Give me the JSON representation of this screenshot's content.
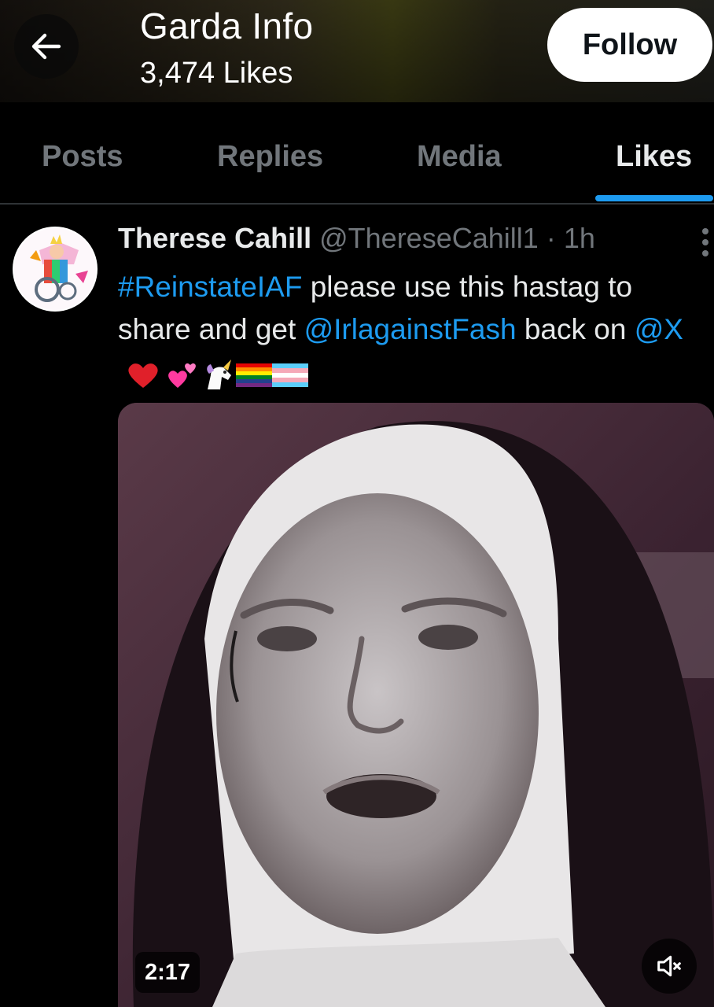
{
  "header": {
    "profile_name": "Garda Info",
    "subtitle": "3,474 Likes",
    "follow_label": "Follow"
  },
  "tabs": [
    {
      "label": "Posts",
      "active": false
    },
    {
      "label": "Replies",
      "active": false
    },
    {
      "label": "Media",
      "active": false
    },
    {
      "label": "Likes",
      "active": true
    }
  ],
  "post": {
    "author_name": "Therese Cahill",
    "author_handle": "@ThereseCahill1",
    "separator": "·",
    "time": "1h",
    "hashtag": "#ReinstateIAF",
    "text_1": "please use this hastag to share and get",
    "mention_1": "@IrlagainstFash",
    "text_2": "back on",
    "mention_2": "@X",
    "emojis": [
      "red-heart",
      "two-hearts",
      "unicorn",
      "rainbow-flag",
      "transgender-flag"
    ],
    "media": {
      "type": "video",
      "duration": "2:17",
      "muted": true
    }
  },
  "colors": {
    "background": "#000000",
    "text": "#e7e9ea",
    "muted_text": "#71767b",
    "accent": "#1d9bf0",
    "follow_bg": "#ffffff"
  }
}
